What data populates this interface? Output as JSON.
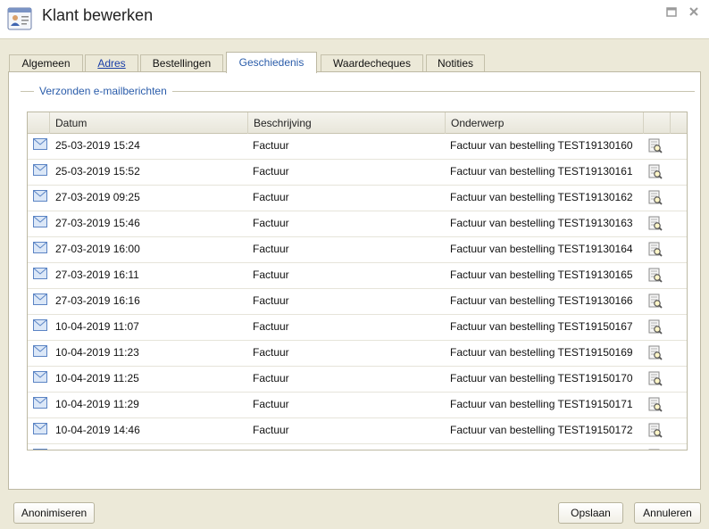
{
  "window": {
    "title": "Klant bewerken"
  },
  "tabs": [
    {
      "label": "Algemeen",
      "active": false,
      "link": false
    },
    {
      "label": "Adres",
      "active": false,
      "link": true
    },
    {
      "label": "Bestellingen",
      "active": false,
      "link": false
    },
    {
      "label": "Geschiedenis",
      "active": true,
      "link": false
    },
    {
      "label": "Waardecheques",
      "active": false,
      "link": false
    },
    {
      "label": "Notities",
      "active": false,
      "link": false
    }
  ],
  "section": {
    "legend": "Verzonden e-mailberichten"
  },
  "grid": {
    "columns": [
      "Datum",
      "Beschrijving",
      "Onderwerp"
    ],
    "rows": [
      {
        "date": "25-03-2019 15:24",
        "description": "Factuur",
        "subject": "Factuur van bestelling TEST19130160"
      },
      {
        "date": "25-03-2019 15:52",
        "description": "Factuur",
        "subject": "Factuur van bestelling TEST19130161"
      },
      {
        "date": "27-03-2019 09:25",
        "description": "Factuur",
        "subject": "Factuur van bestelling TEST19130162"
      },
      {
        "date": "27-03-2019 15:46",
        "description": "Factuur",
        "subject": "Factuur van bestelling TEST19130163"
      },
      {
        "date": "27-03-2019 16:00",
        "description": "Factuur",
        "subject": "Factuur van bestelling TEST19130164"
      },
      {
        "date": "27-03-2019 16:11",
        "description": "Factuur",
        "subject": "Factuur van bestelling TEST19130165"
      },
      {
        "date": "27-03-2019 16:16",
        "description": "Factuur",
        "subject": "Factuur van bestelling TEST19130166"
      },
      {
        "date": "10-04-2019 11:07",
        "description": "Factuur",
        "subject": "Factuur van bestelling TEST19150167"
      },
      {
        "date": "10-04-2019 11:23",
        "description": "Factuur",
        "subject": "Factuur van bestelling TEST19150169"
      },
      {
        "date": "10-04-2019 11:25",
        "description": "Factuur",
        "subject": "Factuur van bestelling TEST19150170"
      },
      {
        "date": "10-04-2019 11:29",
        "description": "Factuur",
        "subject": "Factuur van bestelling TEST19150171"
      },
      {
        "date": "10-04-2019 14:46",
        "description": "Factuur",
        "subject": "Factuur van bestelling TEST19150172"
      }
    ],
    "row_icon": "envelope-icon",
    "action_icon": "view-document-icon"
  },
  "buttons": {
    "anonymize": "Anonimiseren",
    "save": "Opslaan",
    "cancel": "Annuleren"
  },
  "colors": {
    "background": "#ece9d8",
    "accent": "#2a5caa",
    "link": "#1a3ea8"
  }
}
